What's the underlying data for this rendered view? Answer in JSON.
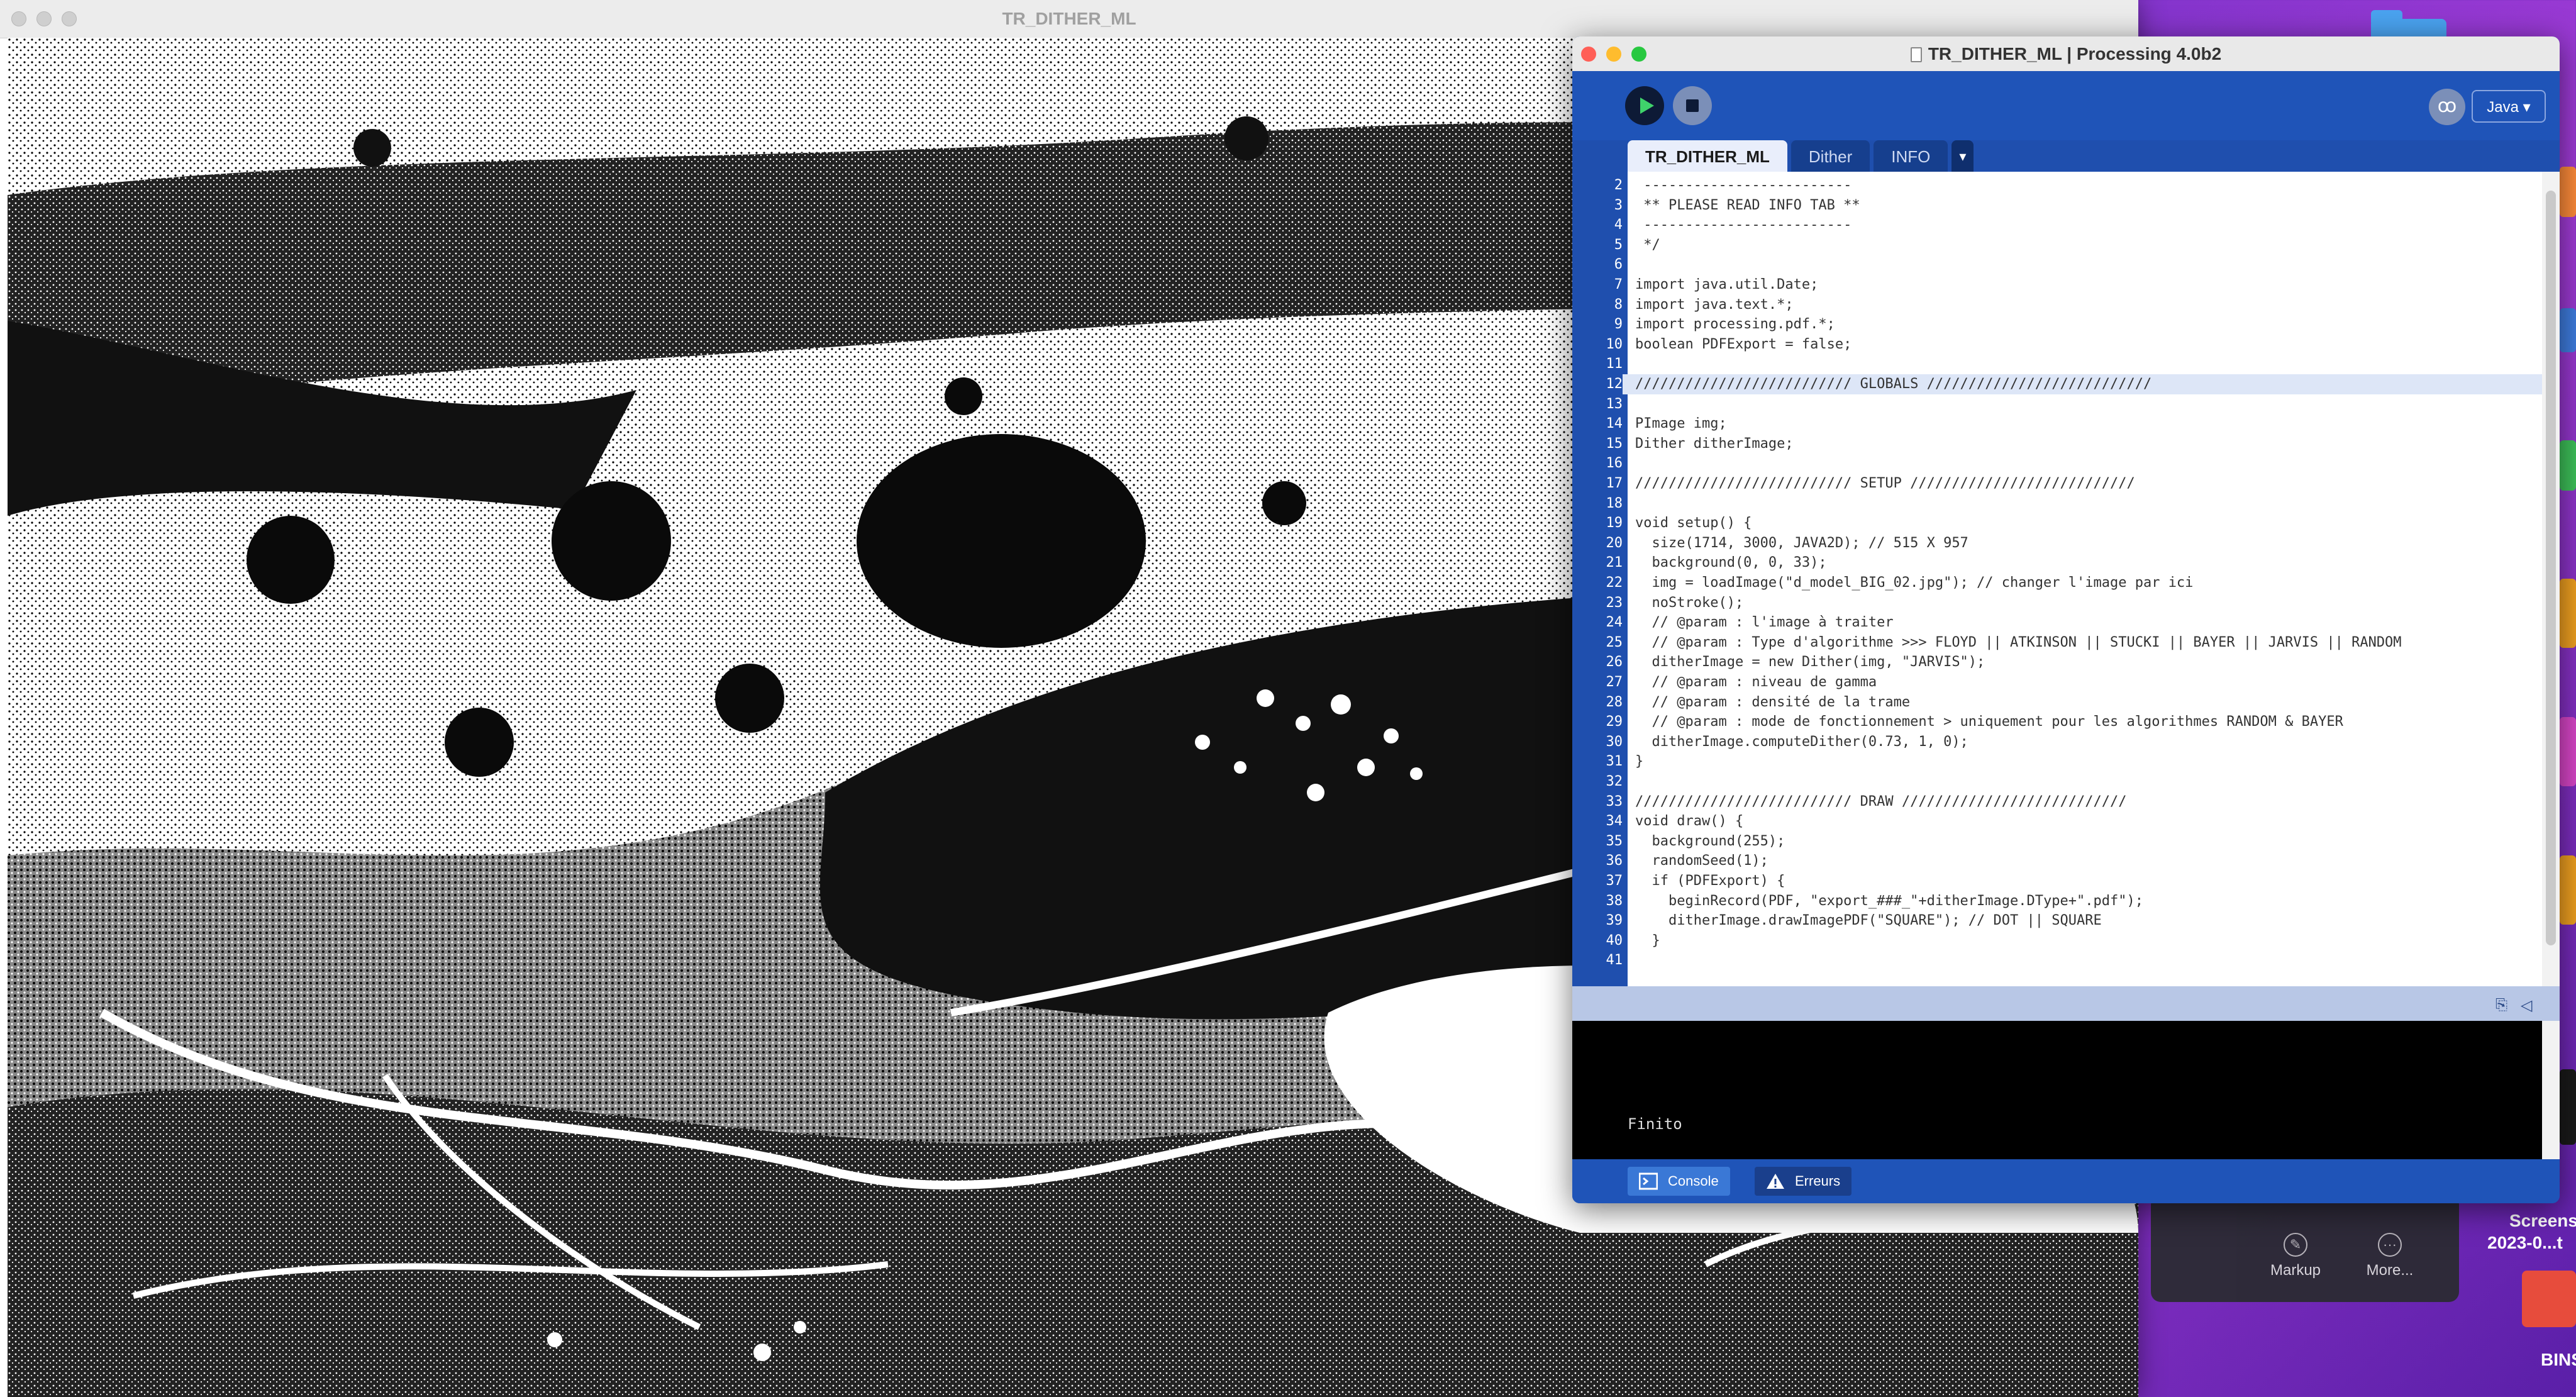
{
  "sketch_window": {
    "title": "TR_DITHER_ML"
  },
  "ide": {
    "title": "TR_DITHER_ML | Processing 4.0b2",
    "mode": "Java ▾",
    "tabs": [
      {
        "label": "TR_DITHER_ML",
        "active": true
      },
      {
        "label": "Dither",
        "active": false
      },
      {
        "label": "INFO",
        "active": false
      }
    ],
    "tab_menu": "▾",
    "code_lines": [
      {
        "n": "2",
        "text": " -------------------------"
      },
      {
        "n": "3",
        "text": " ** PLEASE READ INFO TAB **"
      },
      {
        "n": "4",
        "text": " -------------------------"
      },
      {
        "n": "5",
        "text": " */"
      },
      {
        "n": "6",
        "text": ""
      },
      {
        "n": "7",
        "text": "import java.util.Date;"
      },
      {
        "n": "8",
        "text": "import java.text.*;"
      },
      {
        "n": "9",
        "text": "import processing.pdf.*;"
      },
      {
        "n": "10",
        "text": "boolean PDFExport = false;"
      },
      {
        "n": "11",
        "text": ""
      },
      {
        "n": "12",
        "text": "////////////////////////// GLOBALS ///////////////////////////"
      },
      {
        "n": "13",
        "text": ""
      },
      {
        "n": "14",
        "text": "PImage img;"
      },
      {
        "n": "15",
        "text": "Dither ditherImage;"
      },
      {
        "n": "16",
        "text": ""
      },
      {
        "n": "17",
        "text": "////////////////////////// SETUP ///////////////////////////"
      },
      {
        "n": "18",
        "text": ""
      },
      {
        "n": "19",
        "text": "void setup() {"
      },
      {
        "n": "20",
        "text": "  size(1714, 3000, JAVA2D); // 515 X 957"
      },
      {
        "n": "21",
        "text": "  background(0, 0, 33);"
      },
      {
        "n": "22",
        "text": "  img = loadImage(\"d_model_BIG_02.jpg\"); // changer l'image par ici"
      },
      {
        "n": "23",
        "text": "  noStroke();"
      },
      {
        "n": "24",
        "text": "  // @param : l'image à traiter"
      },
      {
        "n": "25",
        "text": "  // @param : Type d'algorithme >>> FLOYD || ATKINSON || STUCKI || BAYER || JARVIS || RANDOM"
      },
      {
        "n": "26",
        "text": "  ditherImage = new Dither(img, \"JARVIS\");"
      },
      {
        "n": "27",
        "text": "  // @param : niveau de gamma"
      },
      {
        "n": "28",
        "text": "  // @param : densité de la trame"
      },
      {
        "n": "29",
        "text": "  // @param : mode de fonctionnement > uniquement pour les algorithmes RANDOM & BAYER"
      },
      {
        "n": "30",
        "text": "  ditherImage.computeDither(0.73, 1, 0);"
      },
      {
        "n": "31",
        "text": "}"
      },
      {
        "n": "32",
        "text": ""
      },
      {
        "n": "33",
        "text": "////////////////////////// DRAW ///////////////////////////"
      },
      {
        "n": "34",
        "text": "void draw() {"
      },
      {
        "n": "35",
        "text": "  background(255);"
      },
      {
        "n": "36",
        "text": "  randomSeed(1);"
      },
      {
        "n": "37",
        "text": "  if (PDFExport) {"
      },
      {
        "n": "38",
        "text": "    beginRecord(PDF, \"export_###_\"+ditherImage.DType+\".pdf\");"
      },
      {
        "n": "39",
        "text": "    ditherImage.drawImagePDF(\"SQUARE\"); // DOT || SQUARE"
      },
      {
        "n": "40",
        "text": "  }"
      },
      {
        "n": "41",
        "text": ""
      }
    ],
    "highlighted_line": "12",
    "console_output": "Finito",
    "bottom_tabs": {
      "console": "Console",
      "errors": "Erreurs"
    }
  },
  "desktop": {
    "preview_buttons": {
      "markup": "Markup",
      "more": "More..."
    },
    "screenshot_label_1": "Screens",
    "screenshot_label_2": "2023-0...t",
    "folder_label": "BINS"
  }
}
